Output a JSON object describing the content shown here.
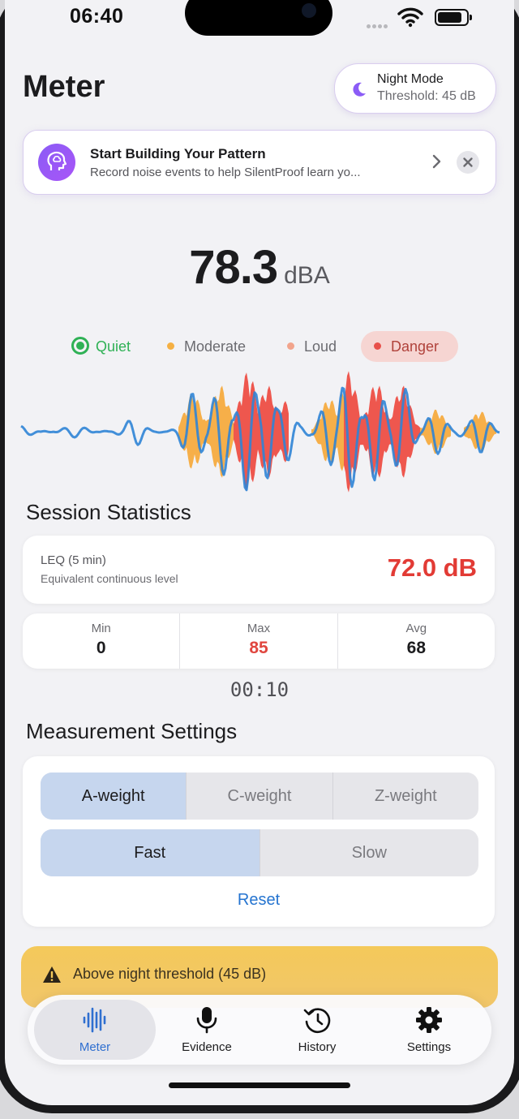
{
  "status": {
    "time": "06:40"
  },
  "header": {
    "title": "Meter"
  },
  "night_mode": {
    "title": "Night Mode",
    "threshold": "Threshold: 45 dB",
    "icon": "moon-icon",
    "color": "#8b5cf6"
  },
  "banner": {
    "title": "Start Building Your Pattern",
    "subtitle": "Record noise events to help SilentProof learn yo...",
    "icon": "head-brain-icon"
  },
  "reading": {
    "value": "78.3",
    "unit": "dBA"
  },
  "levels": [
    {
      "label": "Quiet",
      "color": "#2fb155"
    },
    {
      "label": "Moderate",
      "color": "#f5b043"
    },
    {
      "label": "Loud",
      "color": "#f2a48c"
    },
    {
      "label": "Danger",
      "color": "#e8504a",
      "active": true
    }
  ],
  "session": {
    "title": "Session Statistics",
    "leq_label": "LEQ (5 min)",
    "leq_sub": "Equivalent continuous level",
    "leq_value": "72.0 dB",
    "min_label": "Min",
    "min_value": "0",
    "max_label": "Max",
    "max_value": "85",
    "avg_label": "Avg",
    "avg_value": "68",
    "timer": "00:10"
  },
  "settings": {
    "title": "Measurement Settings",
    "weightings": [
      "A-weight",
      "C-weight",
      "Z-weight"
    ],
    "selected_weighting": "A-weight",
    "responses": [
      "Fast",
      "Slow"
    ],
    "selected_response": "Fast",
    "reset_label": "Reset"
  },
  "warning": {
    "text": "Above night threshold (45 dB)",
    "color": "#f4c95a"
  },
  "tabs": [
    {
      "label": "Meter",
      "icon": "waveform-icon",
      "active": true
    },
    {
      "label": "Evidence",
      "icon": "microphone-icon"
    },
    {
      "label": "History",
      "icon": "history-clock-icon"
    },
    {
      "label": "Settings",
      "icon": "gear-icon"
    }
  ],
  "colors": {
    "accent": "#2f6fd0",
    "danger": "#e23b35",
    "wave_quiet": "#2f84d6",
    "wave_moderate": "#f6a93a",
    "wave_loud": "#ee4a3f"
  }
}
